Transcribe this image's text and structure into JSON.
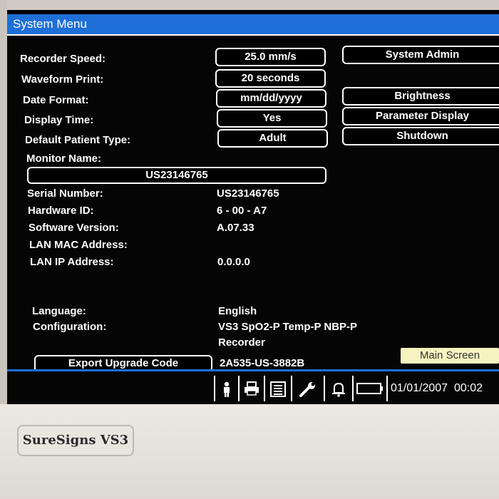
{
  "window": {
    "title": "System Menu"
  },
  "settings": [
    {
      "label": "Recorder Speed:",
      "value": "25.0 mm/s"
    },
    {
      "label": "Waveform Print:",
      "value": "20 seconds"
    },
    {
      "label": "Date Format:",
      "value": "mm/dd/yyyy"
    },
    {
      "label": "Display Time:",
      "value": "Yes"
    },
    {
      "label": "Default Patient Type:",
      "value": "Adult"
    }
  ],
  "side_buttons": {
    "system_admin": "System Admin",
    "brightness": "Brightness",
    "parameter_display": "Parameter Display",
    "shutdown": "Shutdown"
  },
  "monitor": {
    "name_label": "Monitor Name:",
    "name_value": "US23146765"
  },
  "info": [
    {
      "label": "Serial Number:",
      "value": "US23146765"
    },
    {
      "label": "Hardware ID:",
      "value": "6 - 00 - A7"
    },
    {
      "label": "Software Version:",
      "value": "A.07.33"
    },
    {
      "label": "LAN MAC Address:",
      "value": ""
    },
    {
      "label": "LAN IP Address:",
      "value": "0.0.0.0"
    }
  ],
  "language": {
    "label": "Language:",
    "value": "English"
  },
  "configuration": {
    "label": "Configuration:",
    "value_line1": "VS3 SpO2-P Temp-P NBP-P",
    "value_line2": "Recorder"
  },
  "upgrade": {
    "button_label": "Export Upgrade Code",
    "code": "2A535-US-3882B"
  },
  "main_screen_label": "Main Screen",
  "status_bar": {
    "icons": [
      "patient-icon",
      "print-icon",
      "list-icon",
      "wrench-icon",
      "bell-icon",
      "battery-icon"
    ],
    "date": "01/01/2007",
    "time": "00:02"
  },
  "device": {
    "brand": "SureSigns VS3"
  }
}
